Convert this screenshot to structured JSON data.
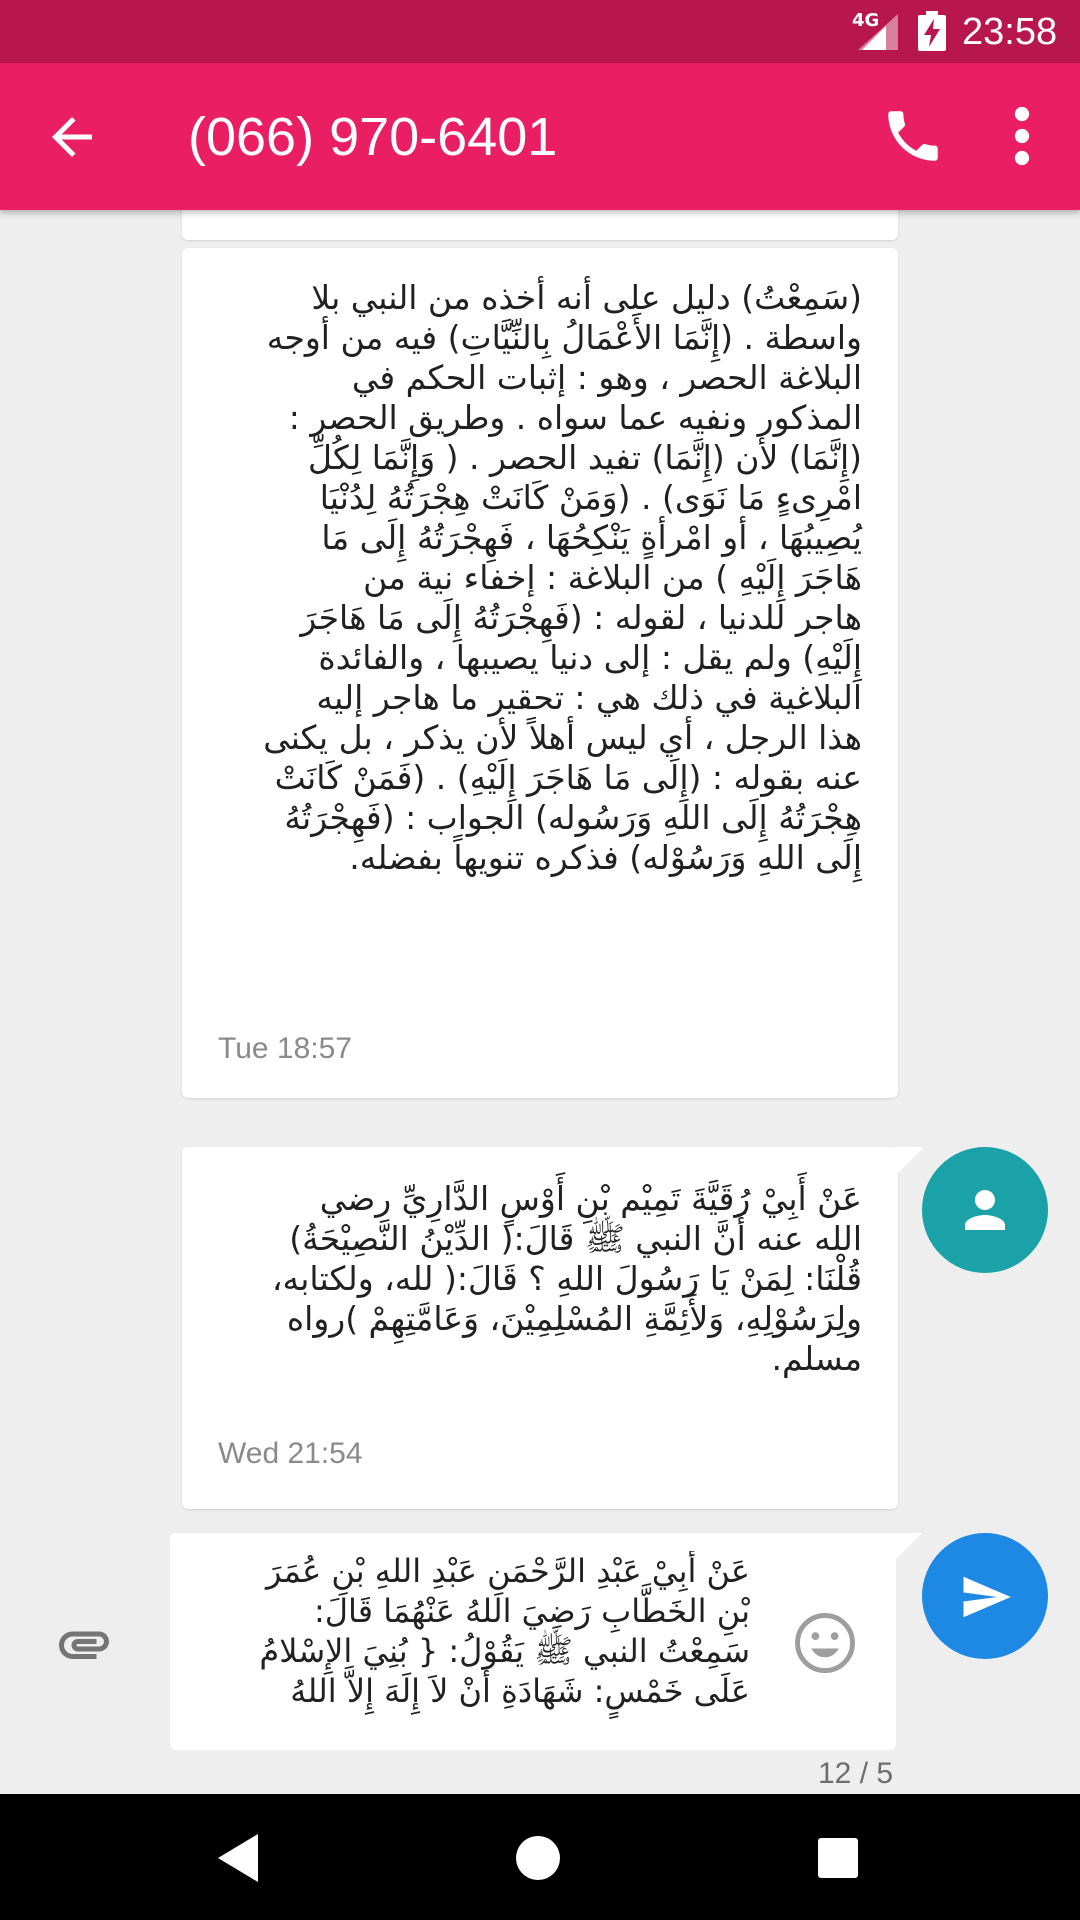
{
  "status_bar": {
    "network": "4G",
    "time": "23:58"
  },
  "header": {
    "title": "(066) 970-6401",
    "color": "#e91e63"
  },
  "messages": [
    {
      "text": "(سَمِعْتُ) دليل على أنه أخذه من النبي بلا\nواسطة . (إِنَّمَا الأَعْمَالُ بِالنِّيَّاتِ) فيه من أوجه\nالبلاغة الحصر ، وهو : إثبات الحكم في\nالمذكور ونفيه عما سواه . وطريق الحصر :\n(إِنَّمَا) لأن (إِنَّمَا) تفيد الحصر . ( وَإِنَّمَا لِكُلِّ\nامْرِىءٍ مَا نَوَى) . (وَمَنْ كَانَتْ هِجْرَتُهُ لِدُنْيَا\nيُصِيبُهَا ، أو امْرأةٍ يَنْكِحُهَا ، فَهِجْرَتُهُ إِلَى مَا\nهَاجَرَ إِلَيْهِ ) من البلاغة : إخفاء نية من\nهاجر للدنيا ، لقوله : (فَهِجْرَتُهُ إِلَى مَا هَاجَرَ\nإِلَيْهِ) ولم يقل : إلى دنيا يصيبها ، والفائدة\nالبلاغية في ذلك هي : تحقير ما هاجر إليه\nهذا الرجل ، أي ليس أهلاً لأن يذكر ، بل يكنى\nعنه بقوله : (إِلَى مَا هَاجَرَ إِلَيْهِ) . (فَمَنْ كَانَتْ\nهِجْرَتُهُ إِلَى اللهِ وَرَسُوله) الجواب : (فَهِجْرَتُهُ\nإِلَى اللهِ وَرَسُوْله) فذكره تنويهاً بفضله.",
      "time": "Tue 18:57"
    },
    {
      "text": "عَنْ أَبِيْ رُقَيَّةَ تَمِيْم بْنِ أَوْسٍ الدَّارِيِّ رضي\nالله عنه أَنَّ النبي ﷺ قَالَ:( الدِّيْنُ النَّصِيْحَةُ)\nقُلْنَا: لِمَنْ يَا رَسُولَ اللهِ ؟ قَالَ:( لله، ولكتابه،\nولِرَسُوْلِهِ، وَلأَئِمَّةِ المُسْلِمِيْنَ، وَعَامَّتِهِمْ )رواه\nمسلم.",
      "time": "Wed 21:54"
    }
  ],
  "compose": {
    "text": "عَنْ أَبِيْ عَبْدِ الرَّحْمَنِ عَبْدِ اللهِ بْنِ عُمَرَ\nبْنِ الخَطَّابِ رَضِيَ اللهُ عَنْهُمَا قَالَ:\nسَمِعْتُ النبي ﷺ يَقُوْلُ: { بُنِيَ الإِسْلامُ\nعَلَى خَمْسٍ: شَهَادَةِ أَنْ لاَ إِلَهَ إِلاَّ اللهُ",
    "counter": "12 / 5",
    "send_color": "#1e88e5"
  },
  "icons": {
    "back": "arrow-back-icon",
    "call": "phone-icon",
    "more": "more-vert-icon",
    "avatar": "person-icon",
    "attach": "paperclip-icon",
    "emoji": "emoji-icon",
    "send": "send-icon"
  }
}
